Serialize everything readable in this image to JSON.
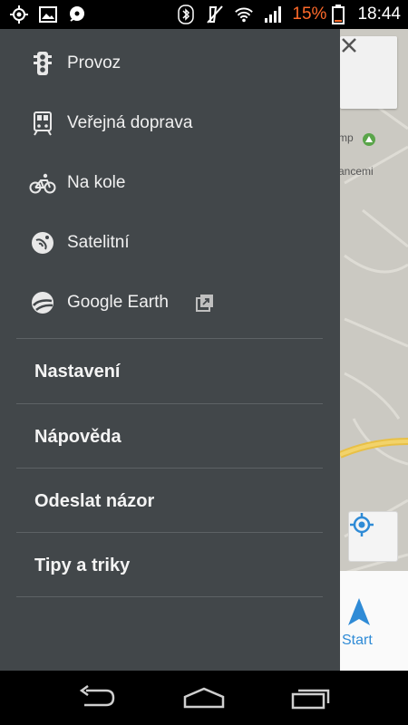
{
  "status_bar": {
    "battery_percent": "15%",
    "time": "18:44",
    "left_icons": [
      "gps-icon",
      "image-icon",
      "music-icon"
    ],
    "right_icons": [
      "bluetooth-icon",
      "mute-icon",
      "wifi-icon",
      "signal-icon",
      "battery-icon"
    ],
    "battery_color": "#ff6a2a"
  },
  "drawer": {
    "layers": [
      {
        "icon": "traffic-light-icon",
        "label": "Provoz"
      },
      {
        "icon": "train-icon",
        "label": "Veřejná doprava"
      },
      {
        "icon": "bicycle-icon",
        "label": "Na kole"
      },
      {
        "icon": "satellite-icon",
        "label": "Satelitní"
      },
      {
        "icon": "earth-icon",
        "label": "Google Earth",
        "external": true
      }
    ],
    "menu": [
      {
        "label": "Nastavení"
      },
      {
        "label": "Nápověda"
      },
      {
        "label": "Odeslat názor"
      },
      {
        "label": "Tipy a triky"
      }
    ]
  },
  "map": {
    "label_camp": "mp",
    "label_hracemi": "ancemi",
    "start_label": "Start",
    "accent_color": "#2f8bd6"
  },
  "nav_bar": {
    "buttons": [
      "back-icon",
      "home-icon",
      "recents-icon"
    ]
  }
}
